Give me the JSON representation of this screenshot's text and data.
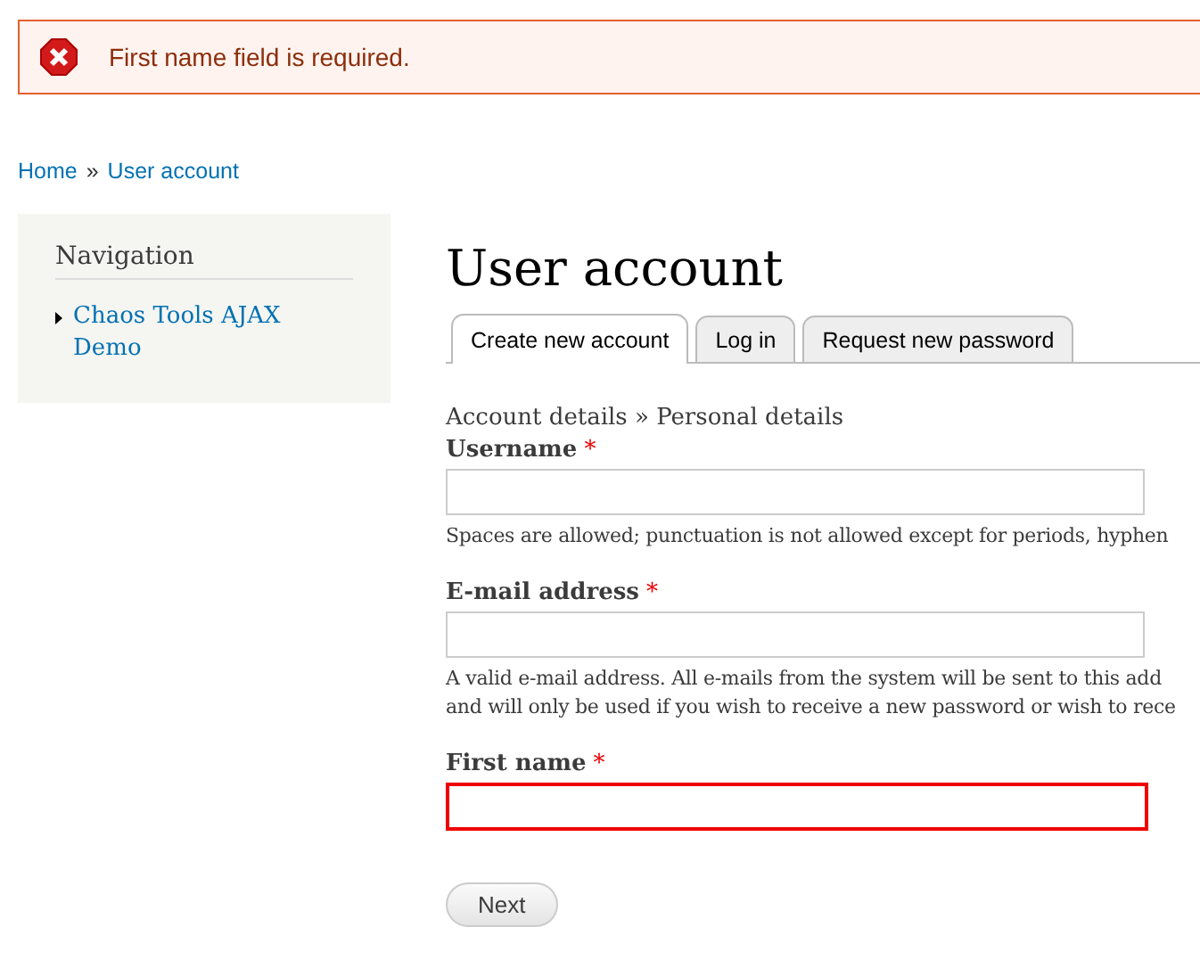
{
  "messages": [
    {
      "kind": "error",
      "text": "First name field is required."
    }
  ],
  "breadcrumb": [
    {
      "label": "Home"
    },
    {
      "label": "User account"
    }
  ],
  "breadcrumb_separator": "»",
  "sidebar": {
    "title": "Navigation",
    "items": [
      {
        "label": "Chaos Tools AJAX Demo"
      }
    ]
  },
  "page": {
    "title": "User account",
    "tabs": [
      {
        "label": "Create new account",
        "selected": true
      },
      {
        "label": "Log in",
        "selected": false
      },
      {
        "label": "Request new password",
        "selected": false
      }
    ],
    "steps": "Account details » Personal details",
    "fields": [
      {
        "label": "Username",
        "required": "*",
        "error": false,
        "description": [
          "Spaces are allowed; punctuation is not allowed except for periods, hyphen"
        ]
      },
      {
        "label": "E-mail address",
        "required": "*",
        "error": false,
        "description": [
          "A valid e-mail address. All e-mails from the system will be sent to this add",
          "and will only be used if you wish to receive a new password or wish to rece"
        ]
      },
      {
        "label": "First name",
        "required": "*",
        "error": true
      }
    ],
    "buttons": [
      {
        "label": "Next"
      }
    ]
  }
}
